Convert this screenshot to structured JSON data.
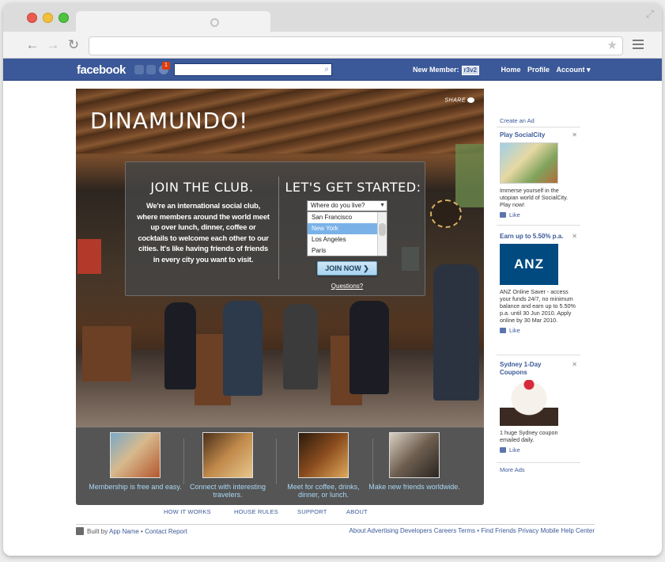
{
  "browser": {
    "tab_title": "",
    "url": "",
    "icons": {
      "back": "back-arrow-icon",
      "forward": "forward-arrow-icon",
      "reload": "reload-icon",
      "bookmark": "star-icon",
      "menu": "hamburger-menu-icon",
      "expand": "fullscreen-icon"
    }
  },
  "fbbar": {
    "logo": "facebook",
    "notification_count": "1",
    "search_placeholder": "",
    "new_member_label": "New Member:",
    "new_member_tag": "r3v2",
    "nav": {
      "home": "Home",
      "profile": "Profile",
      "account": "Account ▾"
    },
    "colors": {
      "bar": "#3b5998"
    }
  },
  "hero": {
    "title": "DINAMUNDO!",
    "share": "SHARE"
  },
  "panel": {
    "join_title": "JOIN THE CLUB.",
    "blurb": "We're an international social club, where members around the world meet up over lunch, dinner, coffee or cocktails to welcome each other to our cities. It's like having friends of friends in every city you want to visit.",
    "start_title": "LET'S GET STARTED:",
    "select_value": "Where do you live?",
    "cities": [
      {
        "label": "San Francisco",
        "selected": false
      },
      {
        "label": "New York",
        "selected": true
      },
      {
        "label": "Los Angeles",
        "selected": false
      },
      {
        "label": "Paris",
        "selected": false
      }
    ],
    "join_button": "JOIN NOW ❯",
    "questions_link": "Questions?"
  },
  "features": [
    {
      "caption": "Membership is free and easy.",
      "icon": "friends-photo"
    },
    {
      "caption": "Connect with interesting travelers.",
      "icon": "travelers-photo"
    },
    {
      "caption": "Meet for coffee, drinks, dinner, or lunch.",
      "icon": "coffee-photo"
    },
    {
      "caption": "Make new friends worldwide.",
      "icon": "friends-worldwide-photo"
    }
  ],
  "subnav": [
    "HOW IT WORKS",
    "HOUSE RULES",
    "SUPPORT",
    "ABOUT"
  ],
  "footer": {
    "built_by": "Built by",
    "app_name": "App Name",
    "contact": "Contact",
    "report": "Report",
    "links": [
      "About",
      "Advertising",
      "Developers",
      "Careers",
      "Terms",
      "•",
      "Find Friends",
      "Privacy",
      "Mobile",
      "Help Center"
    ]
  },
  "sidebar": {
    "create_ad": "Create an Ad",
    "more_ads": "More Ads",
    "like_label": "Like",
    "ads": [
      {
        "title": "Play SocialCity",
        "text": "Immerse yourself in the utopian world of SocialCity. Play now!"
      },
      {
        "title": "Earn up to 5.50% p.a.",
        "text": "ANZ Online Saver - access your funds 24/7, no minimum balance and earn up to 5.50% p.a. until 30 Jun 2010. Apply online by 30 Mar 2010.",
        "logo": "ANZ"
      },
      {
        "title": "Sydney 1-Day Coupons",
        "text": "1 huge Sydney coupon emailed daily."
      }
    ]
  }
}
